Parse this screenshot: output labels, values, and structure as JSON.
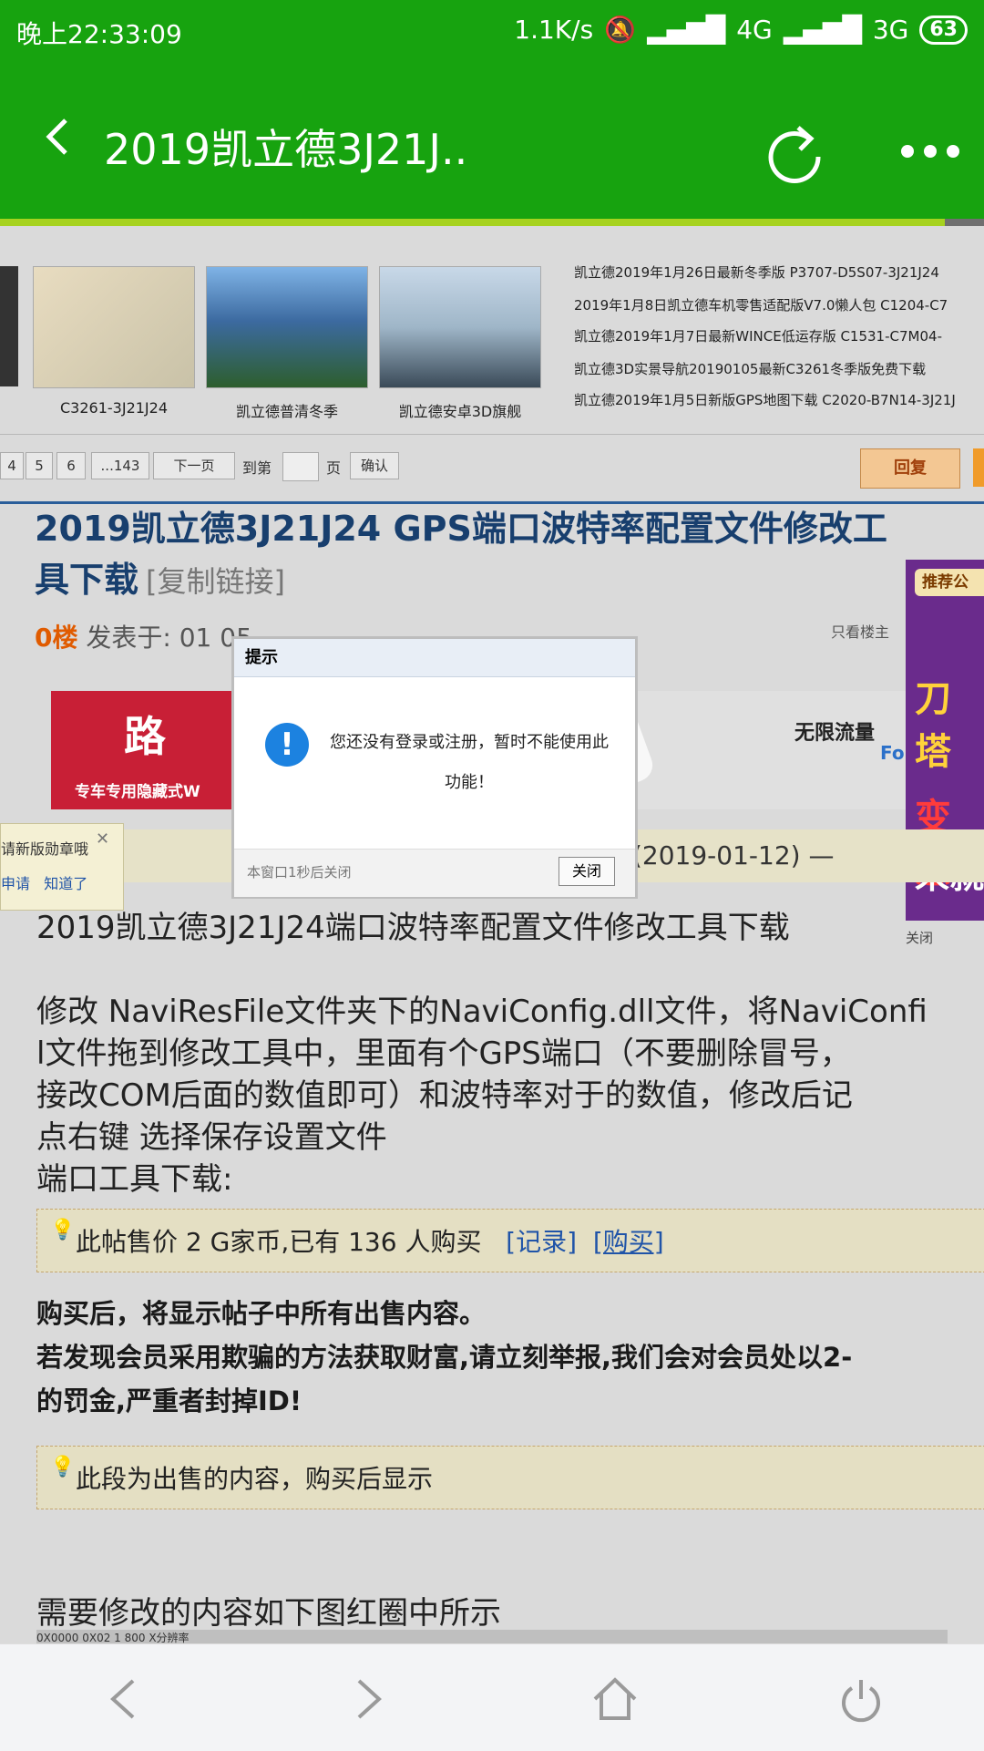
{
  "status": {
    "time": "晚上22:33:09",
    "speed": "1.1K/s",
    "net1": "4G",
    "net2": "3G",
    "battery": "63"
  },
  "titlebar": {
    "title": "2019凯立德3J21J.."
  },
  "thumbs": [
    {
      "caption": "C3261-3J21J24"
    },
    {
      "caption": "凯立德普清冬季"
    },
    {
      "caption": "凯立德安卓3D旗舰"
    }
  ],
  "news": [
    "凯立德2019年1月26日最新冬季版 P3707-D5S07-3J21J24",
    "2019年1月8日凯立德车机零售适配版V7.0懒人包 C1204-C7",
    "凯立德2019年1月7日最新WINCE低运存版 C1531-C7M04-",
    "凯立德3D实景导航20190105最新C3261冬季版免费下载",
    "凯立德2019年1月5日新版GPS地图下载 C2020-B7N14-3J21J"
  ],
  "pager": {
    "p4": "4",
    "p5": "5",
    "p6": "6",
    "last": "...143",
    "next": "下一页",
    "goto": "到第",
    "unit": "页",
    "confirm": "确认",
    "reply": "回复"
  },
  "post": {
    "title": "2019凯立德3J21J24 GPS端口波特率配置文件修改工具下载",
    "copy": "[复制链接]",
    "floor": "0楼",
    "posted": "发表于: 01  05",
    "only_owner": "只看楼主",
    "date": "(2019-01-12) —",
    "line1": "2019凯立德3J21J24端口波特率配置文件修改工具下载",
    "p1": "修改 NaviResFile文件夹下的NaviConfig.dll文件，将NaviConfi",
    "p2": "l文件拖到修改工具中，里面有个GPS端口（不要删除冒号，",
    "p3": "接改COM后面的数值即可）和波特率对于的数值，修改后记",
    "p4": "点右键 选择保存设置文件",
    "p5": "端口工具下载:",
    "sale": "此帖售价 2 G家币,已有 136 人购买",
    "record": "[记录]",
    "buy": "[购买]",
    "b1": "购买后，将显示帖子中所有出售内容。",
    "b2": "若发现会员采用欺骗的方法获取财富,请立刻举报,我们会对会员处以2-",
    "b3": "的罚金,严重者封掉ID!",
    "hidden": "此段为出售的内容，购买后显示",
    "tail": "需要修改的内容如下图红圈中所示",
    "table": "0X0000      0X02     1            800                X分辨率"
  },
  "ad": {
    "brand": "专车专用隐藏式W",
    "logo": "路",
    "unlimited": "无限流量",
    "fo": "Fo",
    "side_tag": "推荐公",
    "side_close": "关闭",
    "side_text1": "刀塔",
    "side_text2": "变态",
    "side_text3": "来就"
  },
  "hint": {
    "text": "请新版勋章哦",
    "apply": "申请",
    "ok": "知道了"
  },
  "modal": {
    "title": "提示",
    "message": "您还没有登录或注册，暂时不能使用此功能！",
    "footer_note": "本窗口1秒后关闭",
    "close_label": "关闭"
  }
}
